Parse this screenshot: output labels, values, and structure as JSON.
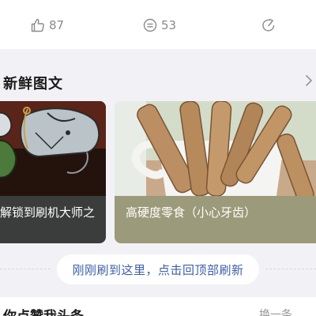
{
  "actions": {
    "like_count": "87",
    "comment_count": "53"
  },
  "section": {
    "title": "新鲜图文"
  },
  "cards": [
    {
      "caption": "解锁到刷机大师之"
    },
    {
      "caption": "高硬度零食（小心牙齿）"
    }
  ],
  "refresh": {
    "label": "刚刚刷到这里，点击回顶部刷新"
  },
  "bottom": {
    "title": "你点赞我头条",
    "action": "换一条"
  },
  "colors": {
    "refresh_text": "#3d5fa8",
    "caption_dark": "#3a3d3c",
    "caption_olive": "#9b9a7a"
  }
}
